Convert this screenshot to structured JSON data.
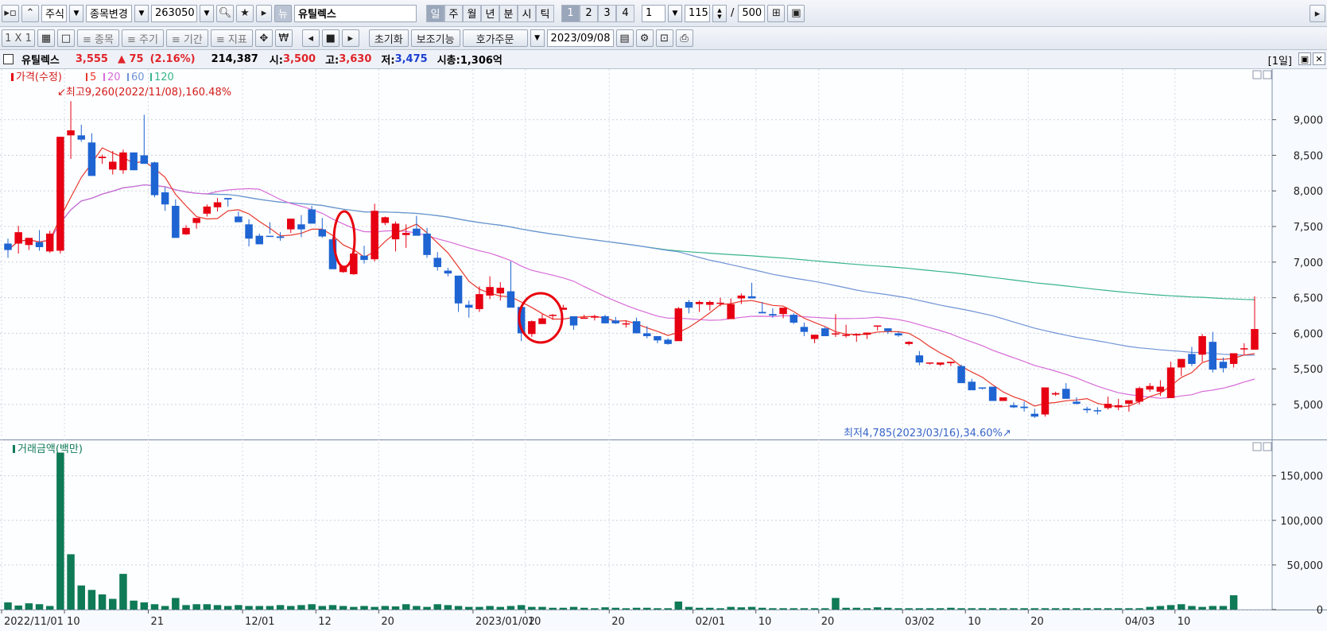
{
  "toolbar1": {
    "market": "주식",
    "change_stock": "종목변경",
    "code": "263050",
    "news_label": "뉴",
    "stock_name": "유틸렉스",
    "period_tabs": [
      "일",
      "주",
      "월",
      "년",
      "분",
      "시",
      "틱"
    ],
    "number_tabs": [
      "1",
      "2",
      "3",
      "4"
    ],
    "interval_value": "1",
    "count_value": "115",
    "count_sep": "/",
    "count_max": "500"
  },
  "toolbar2": {
    "layout": "1 X 1",
    "btn_item": "≡ 종목",
    "btn_cycle": "≡ 주기",
    "btn_period": "≡ 기간",
    "btn_indicator": "≡ 지표",
    "reset": "초기화",
    "aux": "보조기능",
    "order": "호가주문",
    "date": "2023/09/08"
  },
  "info": {
    "name": "유틸렉스",
    "price": "3,555",
    "change": "▲ 75",
    "change_pct": "(2.16%)",
    "volume": "214,387",
    "open_label": "시:",
    "open": "3,500",
    "high_label": "고:",
    "high": "3,630",
    "low_label": "저:",
    "low": "3,475",
    "mcap_label": "시총:",
    "mcap": "1,306억",
    "period_badge": "[1일]"
  },
  "colors": {
    "up": "#e60012",
    "down": "#1e64d2",
    "ma5": "#e8372c",
    "ma20": "#d86bd8",
    "ma60": "#6f93d6",
    "ma120": "#37b48a",
    "volume": "#0f7a56"
  },
  "chart_data": [
    {
      "type": "candlestick",
      "title": "가격(수정)",
      "legend": [
        "5",
        "20",
        "60",
        "120"
      ],
      "ylim": [
        4520,
        9710
      ],
      "yticks": [
        5000,
        5500,
        6000,
        6500,
        7000,
        7500,
        8000,
        8500,
        9000
      ],
      "ytick_labels": [
        "5,000",
        "5,500",
        "6,000",
        "6,500",
        "7,000",
        "7,500",
        "8,000",
        "8,500",
        "9,000"
      ],
      "annotation_high": "최고9,260(2022/11/08),160.48%",
      "annotation_low": "최저4,785(2023/03/16),34.60%",
      "candles": [
        [
          7260,
          7330,
          7060,
          7170
        ],
        [
          7260,
          7510,
          7120,
          7420
        ],
        [
          7240,
          7340,
          7170,
          7340
        ],
        [
          7280,
          7450,
          7160,
          7210
        ],
        [
          7150,
          7440,
          7130,
          7400
        ],
        [
          7160,
          8760,
          7120,
          8760
        ],
        [
          8780,
          9260,
          8450,
          8850
        ],
        [
          8780,
          8930,
          8690,
          8720
        ],
        [
          8680,
          8810,
          8230,
          8210
        ],
        [
          8460,
          8510,
          8380,
          8480
        ],
        [
          8300,
          8560,
          8230,
          8410
        ],
        [
          8290,
          8580,
          8240,
          8540
        ],
        [
          8540,
          8540,
          8290,
          8290
        ],
        [
          8500,
          9070,
          8430,
          8380
        ],
        [
          8400,
          8410,
          7910,
          7940
        ],
        [
          7980,
          8050,
          7720,
          7810
        ],
        [
          7790,
          7880,
          7420,
          7340
        ],
        [
          7390,
          7520,
          7380,
          7480
        ],
        [
          7550,
          7580,
          7470,
          7620
        ],
        [
          7680,
          7810,
          7640,
          7780
        ],
        [
          7770,
          7900,
          7710,
          7840
        ],
        [
          7900,
          7900,
          7780,
          7880
        ],
        [
          7640,
          7710,
          7630,
          7560
        ],
        [
          7530,
          7600,
          7220,
          7330
        ],
        [
          7370,
          7400,
          7270,
          7250
        ],
        [
          7370,
          7560,
          7400,
          7360
        ],
        [
          7360,
          7420,
          7300,
          7340
        ],
        [
          7460,
          7560,
          7410,
          7610
        ],
        [
          7530,
          7660,
          7350,
          7460
        ],
        [
          7740,
          7790,
          7580,
          7540
        ],
        [
          7460,
          7620,
          7340,
          7360
        ],
        [
          7320,
          7350,
          6930,
          6900
        ],
        [
          6860,
          6940,
          6850,
          6950
        ],
        [
          6830,
          7100,
          6820,
          7120
        ],
        [
          7090,
          7230,
          6980,
          7030
        ],
        [
          7040,
          7820,
          7010,
          7720
        ],
        [
          7550,
          7640,
          7520,
          7630
        ],
        [
          7320,
          7570,
          7150,
          7540
        ],
        [
          7380,
          7530,
          7200,
          7410
        ],
        [
          7470,
          7650,
          7390,
          7370
        ],
        [
          7400,
          7480,
          7060,
          7100
        ],
        [
          7060,
          7140,
          6880,
          6930
        ],
        [
          6880,
          6920,
          6800,
          6840
        ],
        [
          6810,
          6800,
          6300,
          6420
        ],
        [
          6400,
          6460,
          6220,
          6360
        ],
        [
          6340,
          6660,
          6300,
          6550
        ],
        [
          6530,
          6800,
          6480,
          6650
        ],
        [
          6560,
          6720,
          6460,
          6640
        ],
        [
          6590,
          7010,
          6400,
          6360
        ],
        [
          6370,
          6360,
          5890,
          6000
        ],
        [
          5990,
          6180,
          5950,
          6170
        ],
        [
          6130,
          6270,
          6140,
          6210
        ],
        [
          6250,
          6270,
          6190,
          6260
        ],
        [
          6330,
          6400,
          6340,
          6360
        ],
        [
          6240,
          6210,
          6050,
          6110
        ],
        [
          6210,
          6260,
          6220,
          6220
        ],
        [
          6220,
          6260,
          6180,
          6240
        ],
        [
          6240,
          6260,
          6140,
          6140
        ],
        [
          6180,
          6230,
          6130,
          6140
        ],
        [
          6140,
          6180,
          6080,
          6140
        ],
        [
          6170,
          6220,
          6000,
          6000
        ],
        [
          6000,
          6100,
          5930,
          5960
        ],
        [
          5960,
          5950,
          5860,
          5900
        ],
        [
          5910,
          5930,
          5840,
          5850
        ],
        [
          5890,
          6370,
          5910,
          6350
        ],
        [
          6440,
          6470,
          6280,
          6360
        ],
        [
          6410,
          6460,
          6300,
          6440
        ],
        [
          6400,
          6460,
          6320,
          6440
        ],
        [
          6430,
          6500,
          6380,
          6430
        ],
        [
          6200,
          6490,
          6200,
          6410
        ],
        [
          6490,
          6560,
          6410,
          6530
        ],
        [
          6520,
          6710,
          6510,
          6490
        ],
        [
          6300,
          6440,
          6290,
          6280
        ],
        [
          6270,
          6350,
          6220,
          6250
        ],
        [
          6270,
          6320,
          6210,
          6360
        ],
        [
          6260,
          6280,
          6130,
          6150
        ],
        [
          6090,
          6150,
          5960,
          6020
        ],
        [
          5920,
          5930,
          5860,
          5980
        ],
        [
          6070,
          6090,
          5980,
          5960
        ],
        [
          5990,
          6270,
          5950,
          6000
        ],
        [
          5980,
          6120,
          5940,
          5980
        ],
        [
          5970,
          6000,
          5880,
          5990
        ],
        [
          5980,
          6010,
          5920,
          6010
        ],
        [
          6100,
          6100,
          6040,
          6110
        ],
        [
          6070,
          6070,
          5990,
          6030
        ],
        [
          6000,
          6020,
          5950,
          5970
        ],
        [
          5850,
          5890,
          5830,
          5880
        ],
        [
          5690,
          5750,
          5550,
          5590
        ],
        [
          5580,
          5590,
          5560,
          5590
        ],
        [
          5560,
          5580,
          5540,
          5590
        ],
        [
          5580,
          5600,
          5540,
          5600
        ],
        [
          5540,
          5560,
          5330,
          5300
        ],
        [
          5320,
          5360,
          5210,
          5200
        ],
        [
          5240,
          5230,
          5210,
          5230
        ],
        [
          5250,
          5180,
          5050,
          5050
        ],
        [
          5050,
          5070,
          5060,
          5100
        ],
        [
          4990,
          5030,
          4950,
          4960
        ],
        [
          4970,
          5040,
          4900,
          4950
        ],
        [
          4870,
          4940,
          4810,
          4830
        ],
        [
          4860,
          5240,
          4830,
          5240
        ],
        [
          5140,
          5180,
          5120,
          5160
        ],
        [
          5220,
          5300,
          5110,
          5080
        ],
        [
          5040,
          5100,
          5000,
          5010
        ],
        [
          4940,
          4970,
          4880,
          4920
        ],
        [
          4920,
          4960,
          4860,
          4910
        ],
        [
          4950,
          5110,
          4930,
          5010
        ],
        [
          4960,
          5080,
          4920,
          4990
        ],
        [
          5010,
          5050,
          4900,
          5060
        ],
        [
          5040,
          5250,
          5000,
          5230
        ],
        [
          5210,
          5300,
          5180,
          5260
        ],
        [
          5180,
          5340,
          5120,
          5250
        ],
        [
          5090,
          5600,
          5100,
          5520
        ],
        [
          5520,
          5620,
          5400,
          5640
        ],
        [
          5710,
          5810,
          5540,
          5570
        ],
        [
          5700,
          5990,
          5600,
          5960
        ],
        [
          5880,
          6020,
          5450,
          5490
        ],
        [
          5600,
          5660,
          5450,
          5510
        ],
        [
          5570,
          5720,
          5520,
          5720
        ],
        [
          5790,
          5860,
          5700,
          5790
        ],
        [
          5770,
          6520,
          5770,
          6060
        ]
      ],
      "series_ma_labels": [
        "5",
        "20",
        "60",
        "120"
      ]
    },
    {
      "type": "bar",
      "title": "거래금액(백만)",
      "ylim": [
        0,
        180000
      ],
      "yticks": [
        0,
        50000,
        100000,
        150000
      ],
      "ytick_labels": [
        "0",
        "50,000",
        "100,000",
        "150,000"
      ],
      "x_tick_labels": [
        "2022/11/01",
        "10",
        "21",
        "12/01",
        "12",
        "20",
        "2023/01/02",
        "10",
        "20",
        "02/01",
        "10",
        "20",
        "03/02",
        "10",
        "20",
        "04/03",
        "10"
      ],
      "values": [
        8000,
        4500,
        7000,
        6000,
        4000,
        176000,
        62000,
        27000,
        22000,
        17000,
        12000,
        40000,
        10000,
        8000,
        6000,
        4000,
        13000,
        5000,
        6000,
        6000,
        5000,
        4000,
        5000,
        4000,
        4000,
        4000,
        5000,
        4000,
        5000,
        6000,
        4000,
        5000,
        4000,
        3000,
        4000,
        3000,
        4000,
        3500,
        6000,
        4000,
        3000,
        6000,
        5000,
        4000,
        3000,
        3000,
        4000,
        3000,
        4000,
        5000,
        3000,
        3000,
        2000,
        2000,
        3000,
        2000,
        1500,
        2500,
        2000,
        1500,
        2000,
        2000,
        1500,
        1500,
        9000,
        3000,
        2000,
        2000,
        1500,
        3000,
        2500,
        3000,
        2000,
        1500,
        1500,
        1500,
        1500,
        1500,
        1500,
        13000,
        2000,
        2000,
        1500,
        2500,
        2000,
        1500,
        1500,
        1500,
        1500,
        1500,
        2000,
        1500,
        1500,
        1500,
        1500,
        1500,
        1500,
        1500,
        1500,
        1500,
        1500,
        1500,
        1500,
        1500,
        1500,
        1500,
        1500,
        1500,
        1500,
        3000,
        4000,
        5000,
        6000,
        4000,
        3000,
        4000,
        4000,
        16000
      ]
    }
  ]
}
